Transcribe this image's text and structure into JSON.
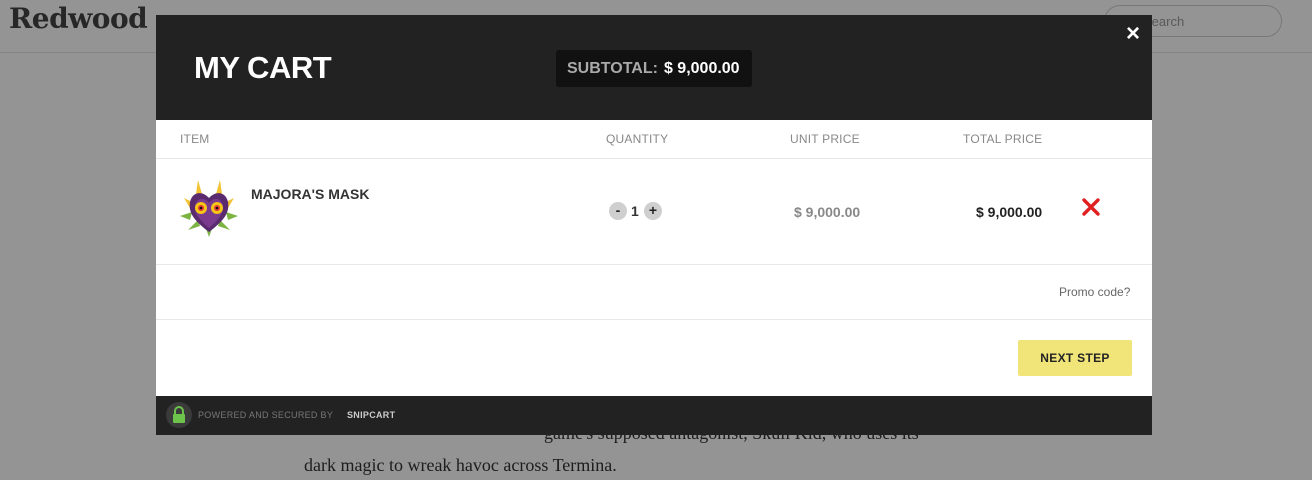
{
  "background": {
    "logo": "Redwood",
    "search_placeholder": "Search",
    "text_line_1": "game's supposed antagonist, Skull Kid, who uses its",
    "text_line_2": "dark magic to wreak havoc across Termina."
  },
  "cart": {
    "title": "MY CART",
    "subtotal_label": "SUBTOTAL:",
    "subtotal_value": "$ 9,000.00",
    "close_icon": "×",
    "columns": {
      "item": "ITEM",
      "quantity": "QUANTITY",
      "unit_price": "UNIT PRICE",
      "total_price": "TOTAL PRICE"
    },
    "items": [
      {
        "name": "MAJORA'S MASK",
        "quantity": "1",
        "unit_price": "$ 9,000.00",
        "total_price": "$ 9,000.00",
        "image_icon": "majoras-mask-image"
      }
    ],
    "qty_minus": "-",
    "qty_plus": "+",
    "remove_icon": "red-x-icon",
    "promo_link": "Promo code?",
    "next_button": "NEXT STEP",
    "footer": {
      "powered_text": "POWERED AND SECURED BY",
      "brand": "SNIPCART",
      "lock_icon": "lock-icon"
    },
    "colors": {
      "header_bg": "#222222",
      "next_button_bg": "#f1e57a",
      "remove_icon": "#e02020",
      "lock_icon": "#6cc24a"
    }
  }
}
